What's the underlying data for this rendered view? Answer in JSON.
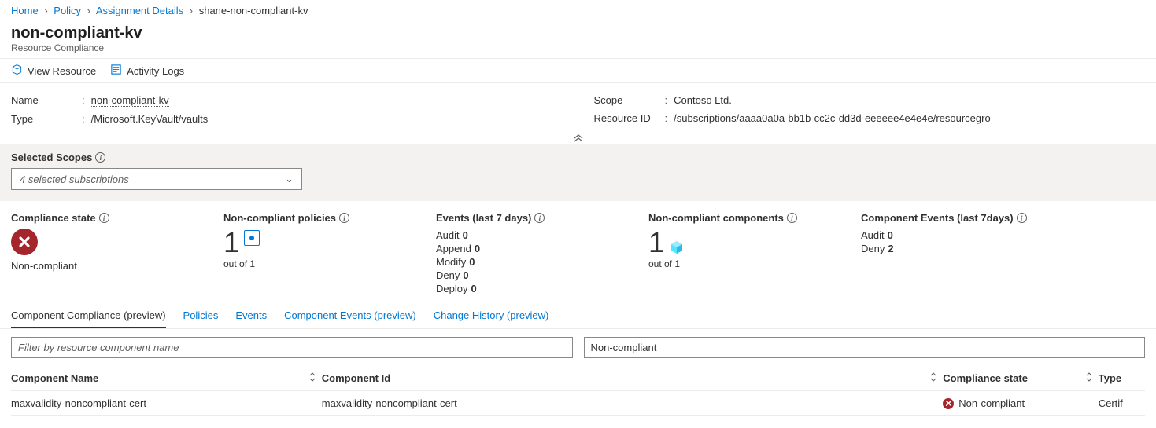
{
  "breadcrumb": {
    "home": "Home",
    "policy": "Policy",
    "assignment": "Assignment Details",
    "current": "shane-non-compliant-kv"
  },
  "page": {
    "title": "non-compliant-kv",
    "subtitle": "Resource Compliance"
  },
  "toolbar": {
    "view_resource": "View Resource",
    "activity_logs": "Activity Logs"
  },
  "props_left": {
    "name_label": "Name",
    "name_value": "non-compliant-kv",
    "type_label": "Type",
    "type_value": "/Microsoft.KeyVault/vaults"
  },
  "props_right": {
    "scope_label": "Scope",
    "scope_value": "Contoso Ltd.",
    "resid_label": "Resource ID",
    "resid_value": "/subscriptions/aaaa0a0a-bb1b-cc2c-dd3d-eeeeee4e4e4e/resourcegro"
  },
  "scopes": {
    "title": "Selected Scopes",
    "selection": "4 selected subscriptions"
  },
  "stats": {
    "compliance": {
      "title": "Compliance state",
      "value": "Non-compliant"
    },
    "noncomp_policies": {
      "title": "Non-compliant policies",
      "count": "1",
      "out_of": "out of 1"
    },
    "events": {
      "title": "Events (last 7 days)",
      "rows": [
        {
          "label": "Audit",
          "value": "0"
        },
        {
          "label": "Append",
          "value": "0"
        },
        {
          "label": "Modify",
          "value": "0"
        },
        {
          "label": "Deny",
          "value": "0"
        },
        {
          "label": "Deploy",
          "value": "0"
        }
      ]
    },
    "noncomp_components": {
      "title": "Non-compliant components",
      "count": "1",
      "out_of": "out of 1"
    },
    "comp_events": {
      "title": "Component Events (last 7days)",
      "rows": [
        {
          "label": "Audit",
          "value": "0"
        },
        {
          "label": "Deny",
          "value": "2"
        }
      ]
    }
  },
  "tabs": {
    "component_compliance": "Component Compliance (preview)",
    "policies": "Policies",
    "events": "Events",
    "component_events": "Component Events (preview)",
    "change_history": "Change History (preview)"
  },
  "filters": {
    "name_placeholder": "Filter by resource component name",
    "state_value": "Non-compliant"
  },
  "table": {
    "headers": {
      "name": "Component Name",
      "id": "Component Id",
      "state": "Compliance state",
      "type": "Type"
    },
    "rows": [
      {
        "name": "maxvalidity-noncompliant-cert",
        "id": "maxvalidity-noncompliant-cert",
        "state": "Non-compliant",
        "type": "Certif"
      }
    ]
  }
}
